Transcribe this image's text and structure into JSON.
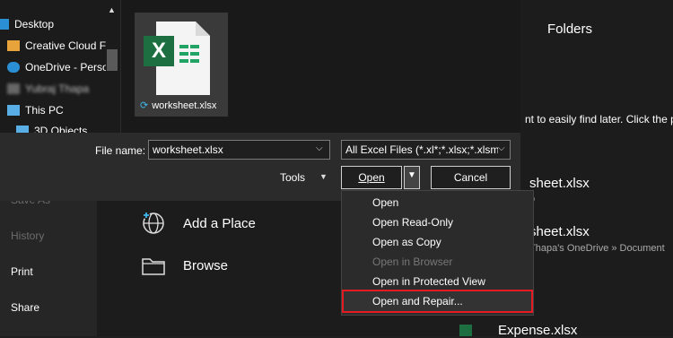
{
  "backstage": {
    "side_items": [
      {
        "label": "Save As",
        "dim": true
      },
      {
        "label": "History",
        "dim": true
      },
      {
        "label": "Print",
        "dim": false
      },
      {
        "label": "Share",
        "dim": false
      }
    ],
    "places": [
      {
        "label": "Add a Place",
        "icon": "globe-icon"
      },
      {
        "label": "Browse",
        "icon": "folder-icon"
      }
    ],
    "folders_title": "Folders",
    "folders_hint": "nt to easily find later. Click the p",
    "recent_files": [
      {
        "name": "sheet.xlsx",
        "sub": "o"
      },
      {
        "name": "sheet.xlsx",
        "sub": "Thapa's OneDrive » Document"
      },
      {
        "name": "Expense.xlsx",
        "sub": ""
      }
    ]
  },
  "dialog": {
    "nav_items": [
      {
        "label": "Desktop",
        "icon": "desktop-icon",
        "color": "#2b8fd6"
      },
      {
        "label": "Creative Cloud F",
        "icon": "creative-cloud-icon",
        "color": "#e8a33b"
      },
      {
        "label": "OneDrive - Perso",
        "icon": "onedrive-icon",
        "color": "#2b8fd6"
      },
      {
        "label": "Yubraj Thapa",
        "icon": "user-folder-icon",
        "color": "#888888"
      },
      {
        "label": "This PC",
        "icon": "this-pc-icon",
        "color": "#5aaee6"
      },
      {
        "label": "3D Objects",
        "icon": "3d-objects-icon",
        "color": "#5aaee6"
      }
    ],
    "file": {
      "name": "worksheet.xlsx",
      "app_letter": "X"
    },
    "file_name_label": "File name:",
    "file_name_value": "worksheet.xlsx",
    "filter_value": "All Excel Files (*.xl*;*.xlsx;*.xlsm",
    "tools_label": "Tools",
    "open_label": "Open",
    "cancel_label": "Cancel",
    "open_menu": [
      {
        "label": "Open",
        "disabled": false
      },
      {
        "label": "Open Read-Only",
        "disabled": false
      },
      {
        "label": "Open as Copy",
        "disabled": false
      },
      {
        "label": "Open in Browser",
        "disabled": true
      },
      {
        "label": "Open in Protected View",
        "disabled": false
      },
      {
        "label": "Open and Repair...",
        "disabled": false,
        "highlighted": true
      }
    ]
  },
  "colors": {
    "excel_green": "#1d6f42",
    "highlight_red": "#e41b23"
  }
}
